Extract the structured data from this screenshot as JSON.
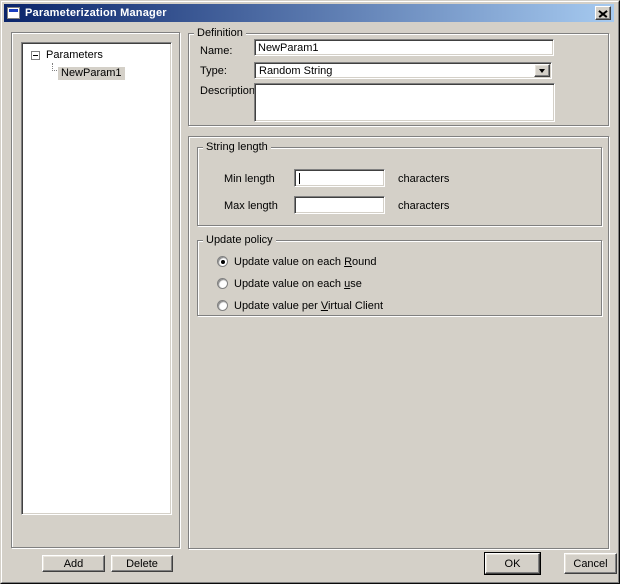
{
  "window": {
    "title": "Parameterization Manager"
  },
  "icons": {
    "close": "close-icon",
    "combo_arrow": "chevron-down-icon",
    "tree_collapse": "minus-icon",
    "app": "window-icon"
  },
  "tree": {
    "root_label": "Parameters",
    "items": [
      {
        "label": "NewParam1",
        "selected": true
      }
    ]
  },
  "tree_buttons": {
    "add": "Add",
    "delete": "Delete"
  },
  "definition": {
    "group_label": "Definition",
    "name_label": "Name:",
    "name_value": "NewParam1",
    "type_label": "Type:",
    "type_value": "Random String",
    "description_label": "Description",
    "description_value": ""
  },
  "string_length": {
    "group_label": "String length",
    "min_label": "Min length",
    "min_value": "",
    "max_label": "Max length",
    "max_value": "",
    "unit_label": "characters"
  },
  "update_policy": {
    "group_label": "Update policy",
    "options": [
      {
        "pre": "Update value on each ",
        "mnemonic": "R",
        "post": "ound",
        "selected": true
      },
      {
        "pre": "Update value on each ",
        "mnemonic": "u",
        "post": "se",
        "selected": false
      },
      {
        "pre": "Update value per ",
        "mnemonic": "V",
        "post": "irtual Client",
        "selected": false
      }
    ]
  },
  "footer": {
    "ok": "OK",
    "cancel": "Cancel"
  },
  "colors": {
    "titlebar_start": "#0A246A",
    "titlebar_end": "#A6CAF0",
    "dialog_bg": "#D4D0C8",
    "inactive_selection": "#D4D0C8"
  }
}
